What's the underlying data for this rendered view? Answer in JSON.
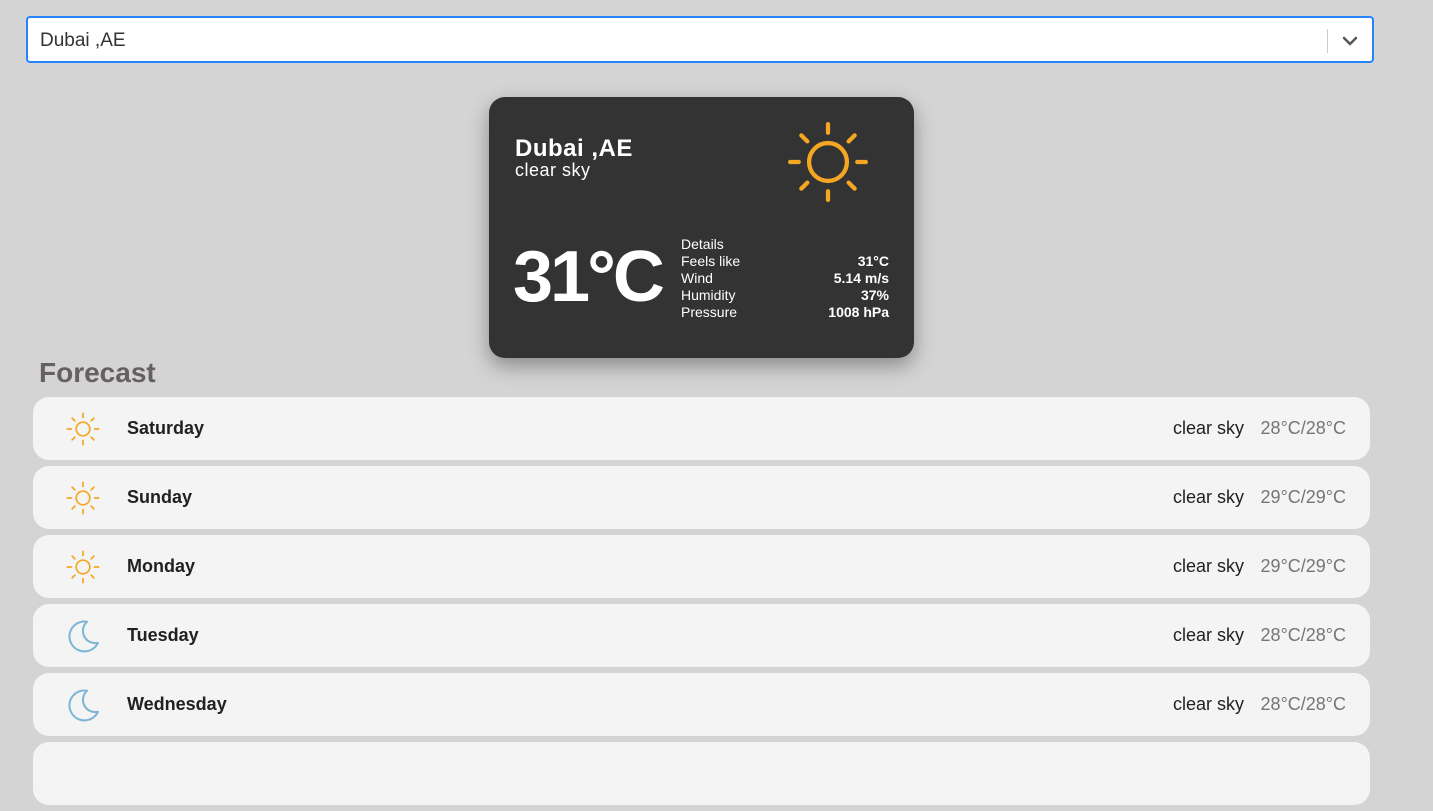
{
  "search": {
    "value": "Dubai ,AE"
  },
  "current": {
    "city": "Dubai ,AE",
    "description": "clear sky",
    "icon": "sun-icon",
    "temperature": "31°C",
    "details_label": "Details",
    "details": [
      {
        "label": "Feels like",
        "value": "31°C"
      },
      {
        "label": "Wind",
        "value": "5.14 m/s"
      },
      {
        "label": "Humidity",
        "value": "37%"
      },
      {
        "label": "Pressure",
        "value": "1008 hPa"
      }
    ]
  },
  "forecast": {
    "title": "Forecast",
    "days": [
      {
        "day": "Saturday",
        "icon": "sun-icon",
        "description": "clear sky",
        "temp": "28°C/28°C"
      },
      {
        "day": "Sunday",
        "icon": "sun-icon",
        "description": "clear sky",
        "temp": "29°C/29°C"
      },
      {
        "day": "Monday",
        "icon": "sun-icon",
        "description": "clear sky",
        "temp": "29°C/29°C"
      },
      {
        "day": "Tuesday",
        "icon": "moon-icon",
        "description": "clear sky",
        "temp": "28°C/28°C"
      },
      {
        "day": "Wednesday",
        "icon": "moon-icon",
        "description": "clear sky",
        "temp": "28°C/28°C"
      }
    ]
  },
  "colors": {
    "sun": "#f5a623",
    "moon": "#7db6d6",
    "card_bg": "#333333",
    "focus_border": "#2684ff"
  }
}
